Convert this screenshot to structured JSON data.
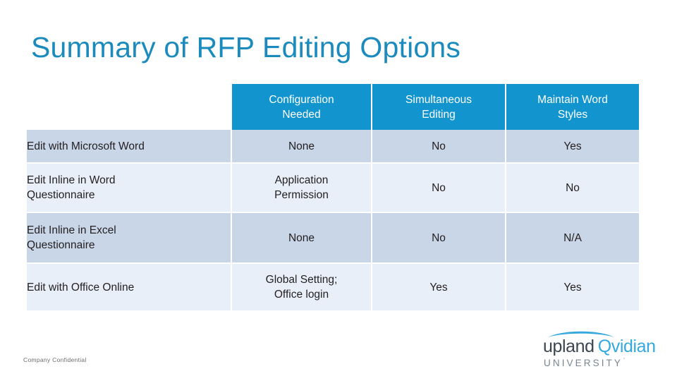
{
  "slide": {
    "title": "Summary of RFP Editing Options",
    "title_color": "#1b8abd",
    "background_color": "#ffffff"
  },
  "table": {
    "header_background": "#1295ce",
    "header_text_color": "#ffffff",
    "row_band_a_color": "#c9d6e8",
    "row_band_b_color": "#e9eff8",
    "corner_label": "",
    "columns": [
      "Configuration\nNeeded",
      "Simultaneous\nEditing",
      "Maintain Word\nStyles"
    ],
    "rows": [
      {
        "label": "Edit with Microsoft Word",
        "configuration_needed": "None",
        "simultaneous_editing": "No",
        "maintain_word_styles": "Yes"
      },
      {
        "label": "Edit Inline in Word\nQuestionnaire",
        "configuration_needed": "Application\nPermission",
        "simultaneous_editing": "No",
        "maintain_word_styles": "No"
      },
      {
        "label": "Edit Inline in Excel\nQuestionnaire",
        "configuration_needed": "None",
        "simultaneous_editing": "No",
        "maintain_word_styles": "N/A"
      },
      {
        "label": "Edit with Office Online",
        "configuration_needed": "Global Setting;\nOffice login",
        "simultaneous_editing": "Yes",
        "maintain_word_styles": "Yes"
      }
    ]
  },
  "footer": {
    "confidentiality_note": "Company Confidential"
  },
  "logo": {
    "primary_word": "upland",
    "secondary_word": "Qvidian",
    "subtitle": "UNIVERSITY",
    "trademark": "ˇ",
    "primary_color": "#3b4650",
    "secondary_color": "#35a8dd",
    "subtitle_color": "#7a858e",
    "swoosh_color": "#35a8dd",
    "swoosh_icon": "arc-swoosh-icon"
  }
}
